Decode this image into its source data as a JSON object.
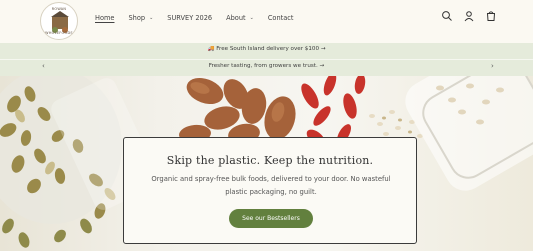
{
  "brand": {
    "logo_top_text": "ROWAN",
    "logo_bottom_text": "WHOLEFOODS"
  },
  "nav": {
    "items": [
      {
        "label": "Home",
        "active": true,
        "has_dropdown": false
      },
      {
        "label": "Shop",
        "active": false,
        "has_dropdown": true
      },
      {
        "label": "SURVEY 2026",
        "active": false,
        "has_dropdown": false
      },
      {
        "label": "About",
        "active": false,
        "has_dropdown": true
      },
      {
        "label": "Contact",
        "active": false,
        "has_dropdown": false
      }
    ],
    "icons": [
      "search-icon",
      "account-icon",
      "cart-icon"
    ]
  },
  "announcement": {
    "line1": "🚚 Free South Island delivery over $100 →",
    "line2": "Fresher tasting, from growers we trust. →",
    "prev_label": "‹",
    "next_label": "›"
  },
  "hero": {
    "title": "Skip the plastic. Keep the nutrition.",
    "subtitle": "Organic and spray-free bulk foods, delivered to your door. No wasteful plastic packaging, no guilt.",
    "button_label": "See our Bestsellers"
  },
  "colors": {
    "background": "#fbf9f2",
    "announcement_bg": "#e5ebdb",
    "button": "#62803e",
    "card_border": "#3b3b3b"
  }
}
